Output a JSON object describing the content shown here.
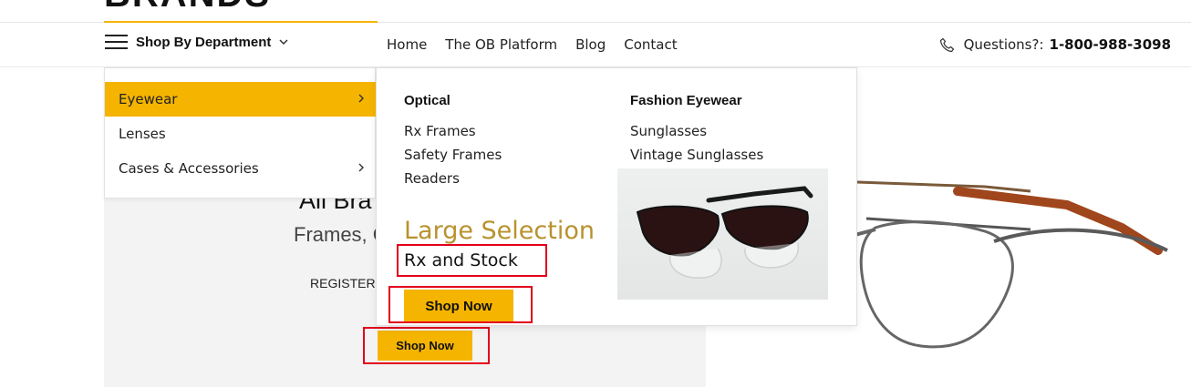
{
  "brand": {
    "logo_text": "BRANDS"
  },
  "nav": {
    "department_label": "Shop By Department",
    "links": [
      "Home",
      "The OB Platform",
      "Blog",
      "Contact"
    ],
    "questions_label": "Questions?:",
    "phone": "1-800-988-3098"
  },
  "hero": {
    "title": "All Bra",
    "subtitle": "Frames, C",
    "register": "REGISTER T",
    "shop_button": "Shop Now"
  },
  "department_menu": {
    "items": [
      {
        "label": "Eyewear",
        "active": true,
        "has_submenu": true
      },
      {
        "label": "Lenses",
        "active": false,
        "has_submenu": false
      },
      {
        "label": "Cases & Accessories",
        "active": false,
        "has_submenu": true
      }
    ]
  },
  "mega_menu": {
    "columns": [
      {
        "heading": "Optical",
        "links": [
          "Rx Frames",
          "Safety Frames",
          "Readers"
        ]
      },
      {
        "heading": "Fashion Eyewear",
        "links": [
          "Sunglasses",
          "Vintage Sunglasses"
        ]
      }
    ],
    "promo": {
      "title": "Large Selection",
      "subtitle": "Rx and Stock",
      "button": "Shop Now"
    }
  },
  "colors": {
    "accent": "#f5b400",
    "promo_title": "#b8922e",
    "highlight": "#e3001b"
  },
  "icons": [
    "hamburger-icon",
    "chevron-down-icon",
    "phone-icon",
    "chevron-right-icon"
  ]
}
